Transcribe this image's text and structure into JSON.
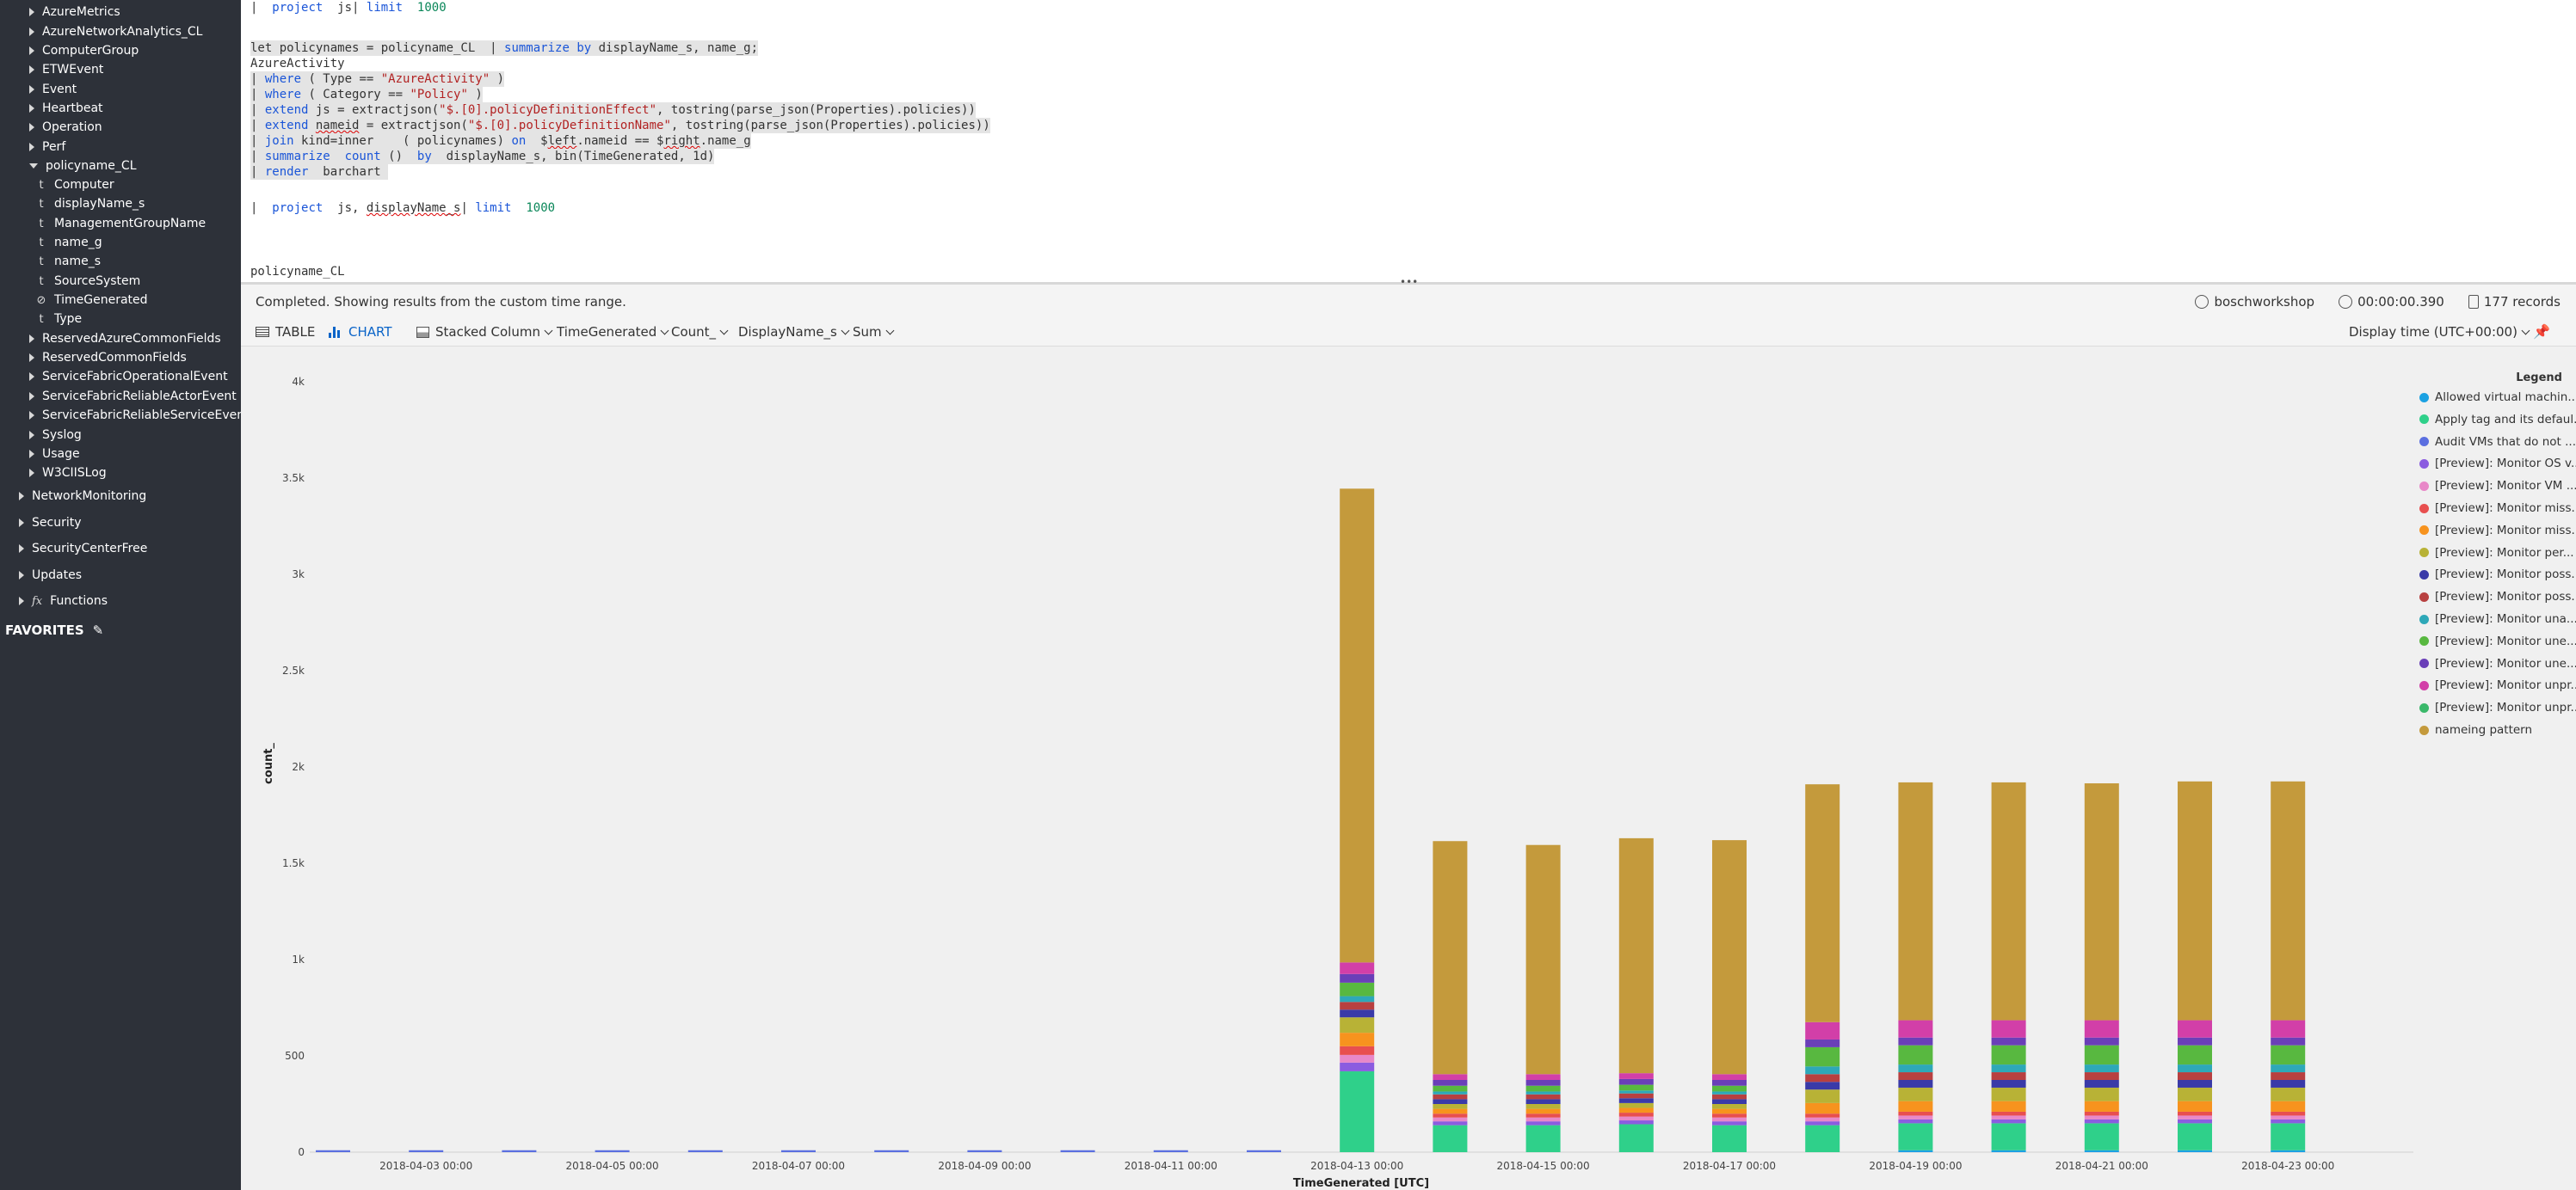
{
  "sidebar": {
    "items": [
      {
        "label": "AzureMetrics",
        "indent": 1,
        "kind": "table"
      },
      {
        "label": "AzureNetworkAnalytics_CL",
        "indent": 1,
        "kind": "table"
      },
      {
        "label": "ComputerGroup",
        "indent": 1,
        "kind": "table"
      },
      {
        "label": "ETWEvent",
        "indent": 1,
        "kind": "table"
      },
      {
        "label": "Event",
        "indent": 1,
        "kind": "table"
      },
      {
        "label": "Heartbeat",
        "indent": 1,
        "kind": "table"
      },
      {
        "label": "Operation",
        "indent": 1,
        "kind": "table"
      },
      {
        "label": "Perf",
        "indent": 1,
        "kind": "table"
      },
      {
        "label": "policyname_CL",
        "indent": 1,
        "kind": "table-open"
      },
      {
        "label": "Computer",
        "indent": 2,
        "kind": "text"
      },
      {
        "label": "displayName_s",
        "indent": 2,
        "kind": "text"
      },
      {
        "label": "ManagementGroupName",
        "indent": 2,
        "kind": "text"
      },
      {
        "label": "name_g",
        "indent": 2,
        "kind": "text"
      },
      {
        "label": "name_s",
        "indent": 2,
        "kind": "text"
      },
      {
        "label": "SourceSystem",
        "indent": 2,
        "kind": "text"
      },
      {
        "label": "TimeGenerated",
        "indent": 2,
        "kind": "time"
      },
      {
        "label": "Type",
        "indent": 2,
        "kind": "text"
      },
      {
        "label": "ReservedAzureCommonFields",
        "indent": 1,
        "kind": "table"
      },
      {
        "label": "ReservedCommonFields",
        "indent": 1,
        "kind": "table"
      },
      {
        "label": "ServiceFabricOperationalEvent",
        "indent": 1,
        "kind": "table"
      },
      {
        "label": "ServiceFabricReliableActorEvent",
        "indent": 1,
        "kind": "table"
      },
      {
        "label": "ServiceFabricReliableServiceEvent",
        "indent": 1,
        "kind": "table"
      },
      {
        "label": "Syslog",
        "indent": 1,
        "kind": "table"
      },
      {
        "label": "Usage",
        "indent": 1,
        "kind": "table"
      },
      {
        "label": "W3CIISLog",
        "indent": 1,
        "kind": "table"
      },
      {
        "label": "NetworkMonitoring",
        "indent": 0,
        "kind": "group"
      },
      {
        "label": "Security",
        "indent": 0,
        "kind": "group"
      },
      {
        "label": "SecurityCenterFree",
        "indent": 0,
        "kind": "group"
      },
      {
        "label": "Updates",
        "indent": 0,
        "kind": "group"
      },
      {
        "label": "Functions",
        "indent": 0,
        "kind": "functions"
      }
    ],
    "text_icon": "t",
    "time_icon": "⊘",
    "fx_icon": "fx",
    "favorites_label": "FAVORITES",
    "favorites_icon": "pencil-icon"
  },
  "editor": {
    "lines": [
      {
        "top": 0,
        "hl": false,
        "tokens": [
          [
            "plain",
            "|  "
          ],
          [
            "kw",
            "project"
          ],
          [
            "plain",
            "  js| "
          ],
          [
            "kw",
            "limit"
          ],
          [
            "plain",
            "  "
          ],
          [
            "num",
            "1000"
          ]
        ]
      },
      {
        "top": 51,
        "hl": true,
        "tokens": [
          [
            "plain",
            "let policynames = policyname_CL  | "
          ],
          [
            "kw",
            "summarize"
          ],
          [
            "plain",
            " "
          ],
          [
            "kw",
            "by"
          ],
          [
            "plain",
            " displayName_s, name_g;"
          ]
        ]
      },
      {
        "top": 69,
        "hl": false,
        "tokens": [
          [
            "plain",
            "AzureActivity"
          ]
        ]
      },
      {
        "top": 87,
        "hl": true,
        "tokens": [
          [
            "plain",
            "| "
          ],
          [
            "kw",
            "where"
          ],
          [
            "plain",
            " ( Type == "
          ],
          [
            "str",
            "\"AzureActivity\""
          ],
          [
            "plain",
            " )"
          ]
        ]
      },
      {
        "top": 105,
        "hl": true,
        "tokens": [
          [
            "plain",
            "| "
          ],
          [
            "kw",
            "where"
          ],
          [
            "plain",
            " ( Category == "
          ],
          [
            "str",
            "\"Policy\""
          ],
          [
            "plain",
            " )"
          ]
        ]
      },
      {
        "top": 123,
        "hl": true,
        "tokens": [
          [
            "plain",
            "| "
          ],
          [
            "kw",
            "extend"
          ],
          [
            "plain",
            " js = extractjson("
          ],
          [
            "str",
            "\"$.[0].policyDefinitionEffect\""
          ],
          [
            "plain",
            ", tostring(parse_json(Properties).policies))"
          ]
        ]
      },
      {
        "top": 141,
        "hl": true,
        "tokens": [
          [
            "plain",
            "| "
          ],
          [
            "kw",
            "extend"
          ],
          [
            "plain",
            " "
          ],
          [
            "squig",
            "nameid"
          ],
          [
            "plain",
            " = extractjson("
          ],
          [
            "str",
            "\"$.[0].policyDefinitionName\""
          ],
          [
            "plain",
            ", tostring(parse_json(Properties).policies))"
          ]
        ]
      },
      {
        "top": 159,
        "hl": true,
        "tokens": [
          [
            "plain",
            "| "
          ],
          [
            "kw",
            "join"
          ],
          [
            "plain",
            " kind=inner    ( policynames) "
          ],
          [
            "kw",
            "on"
          ],
          [
            "plain",
            "  $"
          ],
          [
            "squig",
            "left"
          ],
          [
            "plain",
            ".nameid == $"
          ],
          [
            "squig",
            "right"
          ],
          [
            "plain",
            ".name_g"
          ]
        ]
      },
      {
        "top": 177,
        "hl": true,
        "tokens": [
          [
            "plain",
            "| "
          ],
          [
            "kw",
            "summarize"
          ],
          [
            "plain",
            "  "
          ],
          [
            "kw",
            "count"
          ],
          [
            "plain",
            " ()  "
          ],
          [
            "kw",
            "by"
          ],
          [
            "plain",
            "  displayName_s, bin(TimeGenerated, 1d)"
          ]
        ]
      },
      {
        "top": 195,
        "hl": true,
        "tokens": [
          [
            "plain",
            "| "
          ],
          [
            "kw",
            "render"
          ],
          [
            "plain",
            "  barchart "
          ]
        ]
      },
      {
        "top": 237,
        "hl": false,
        "tokens": [
          [
            "plain",
            "|  "
          ],
          [
            "kw",
            "project"
          ],
          [
            "plain",
            "  js, "
          ],
          [
            "squig",
            "displayName_s"
          ],
          [
            "plain",
            "| "
          ],
          [
            "kw",
            "limit"
          ],
          [
            "plain",
            "  "
          ],
          [
            "num",
            "1000"
          ]
        ]
      },
      {
        "top": 311,
        "hl": false,
        "tokens": [
          [
            "plain",
            "policyname_CL"
          ]
        ]
      }
    ]
  },
  "status": {
    "text": "Completed. Showing results from the custom time range.",
    "workspace": "boschworkshop",
    "duration": "00:00:00.390",
    "records": "177 records"
  },
  "toolbar": {
    "table_label": "TABLE",
    "chart_label": "CHART",
    "chart_type": "Stacked Column",
    "x_field": "TimeGenerated",
    "y_field": "Count_",
    "split_field": "DisplayName_s",
    "aggregation": "Sum",
    "display_time": "Display time (UTC+00:00)",
    "pin_icon": "pin-icon"
  },
  "chart_data": {
    "type": "bar",
    "stacked": true,
    "xlabel": "TimeGenerated [UTC]",
    "ylabel": "count_",
    "ylim": [
      0,
      4000
    ],
    "yticks": [
      0,
      500,
      1000,
      1500,
      2000,
      2500,
      3000,
      3500,
      4000
    ],
    "ytick_labels": [
      "0",
      "500",
      "1k",
      "1.5k",
      "2k",
      "2.5k",
      "3k",
      "3.5k",
      "4k"
    ],
    "xtick_labels": [
      "2018-04-03 00:00",
      "2018-04-05 00:00",
      "2018-04-07 00:00",
      "2018-04-09 00:00",
      "2018-04-11 00:00",
      "2018-04-13 00:00",
      "2018-04-15 00:00",
      "2018-04-17 00:00",
      "2018-04-19 00:00",
      "2018-04-21 00:00",
      "2018-04-23 00:00"
    ],
    "categories": [
      "2018-04-02",
      "2018-04-03",
      "2018-04-04",
      "2018-04-05",
      "2018-04-06",
      "2018-04-07",
      "2018-04-08",
      "2018-04-09",
      "2018-04-10",
      "2018-04-11",
      "2018-04-12",
      "2018-04-13",
      "2018-04-14",
      "2018-04-15",
      "2018-04-16",
      "2018-04-17",
      "2018-04-18",
      "2018-04-19",
      "2018-04-20",
      "2018-04-21",
      "2018-04-22",
      "2018-04-23"
    ],
    "legend_title": "Legend",
    "legend_position": "right",
    "series": [
      {
        "name": "Allowed virtual machin...",
        "color": "#1ba1e2",
        "values": [
          0,
          0,
          0,
          0,
          0,
          0,
          0,
          0,
          0,
          0,
          0,
          0,
          0,
          0,
          0,
          0,
          0,
          10,
          10,
          10,
          10,
          10
        ]
      },
      {
        "name": "Apply tag and its defaul...",
        "color": "#2fd08a",
        "values": [
          0,
          0,
          0,
          0,
          0,
          0,
          0,
          0,
          0,
          0,
          0,
          420,
          140,
          140,
          145,
          140,
          140,
          140,
          140,
          140,
          140,
          140
        ]
      },
      {
        "name": "Audit VMs that do not ...",
        "color": "#5b6fe0",
        "values": [
          10,
          10,
          10,
          10,
          10,
          10,
          10,
          10,
          10,
          10,
          10,
          0,
          0,
          0,
          0,
          0,
          0,
          0,
          0,
          0,
          0,
          0
        ]
      },
      {
        "name": "[Preview]: Monitor OS v...",
        "color": "#8b5ce0",
        "values": [
          0,
          0,
          0,
          0,
          0,
          0,
          0,
          0,
          0,
          0,
          0,
          45,
          20,
          20,
          20,
          20,
          20,
          20,
          20,
          20,
          20,
          20
        ]
      },
      {
        "name": "[Preview]: Monitor VM ...",
        "color": "#e888c8",
        "values": [
          0,
          0,
          0,
          0,
          0,
          0,
          0,
          0,
          0,
          0,
          0,
          40,
          20,
          20,
          20,
          20,
          20,
          20,
          20,
          20,
          20,
          20
        ]
      },
      {
        "name": "[Preview]: Monitor miss...",
        "color": "#e84f4f",
        "values": [
          0,
          0,
          0,
          0,
          0,
          0,
          0,
          0,
          0,
          0,
          0,
          45,
          20,
          20,
          20,
          20,
          20,
          20,
          20,
          20,
          20,
          20
        ]
      },
      {
        "name": "[Preview]: Monitor miss...",
        "color": "#f7931e",
        "values": [
          0,
          0,
          0,
          0,
          0,
          0,
          0,
          0,
          0,
          0,
          0,
          70,
          25,
          25,
          25,
          25,
          55,
          55,
          55,
          55,
          55,
          55
        ]
      },
      {
        "name": "[Preview]: Monitor per...",
        "color": "#b8b236",
        "values": [
          0,
          0,
          0,
          0,
          0,
          0,
          0,
          0,
          0,
          0,
          0,
          80,
          25,
          25,
          25,
          25,
          70,
          70,
          70,
          70,
          70,
          70
        ]
      },
      {
        "name": "[Preview]: Monitor poss...",
        "color": "#3a3aa8",
        "values": [
          0,
          0,
          0,
          0,
          0,
          0,
          0,
          0,
          0,
          0,
          0,
          40,
          25,
          25,
          25,
          25,
          40,
          40,
          40,
          40,
          40,
          40
        ]
      },
      {
        "name": "[Preview]: Monitor poss...",
        "color": "#b84040",
        "values": [
          0,
          0,
          0,
          0,
          0,
          0,
          0,
          0,
          0,
          0,
          0,
          40,
          25,
          25,
          25,
          25,
          40,
          40,
          40,
          40,
          40,
          40
        ]
      },
      {
        "name": "[Preview]: Monitor una...",
        "color": "#2ea8b8",
        "values": [
          0,
          0,
          0,
          0,
          0,
          0,
          0,
          0,
          0,
          0,
          0,
          30,
          15,
          15,
          15,
          15,
          40,
          40,
          40,
          40,
          40,
          40
        ]
      },
      {
        "name": "[Preview]: Monitor une...",
        "color": "#58b840",
        "values": [
          0,
          0,
          0,
          0,
          0,
          0,
          0,
          0,
          0,
          0,
          0,
          70,
          30,
          30,
          30,
          30,
          100,
          100,
          100,
          100,
          100,
          100
        ]
      },
      {
        "name": "[Preview]: Monitor une...",
        "color": "#6a3fb8",
        "values": [
          0,
          0,
          0,
          0,
          0,
          0,
          0,
          0,
          0,
          0,
          0,
          45,
          30,
          30,
          30,
          30,
          40,
          40,
          40,
          40,
          40,
          40
        ]
      },
      {
        "name": "[Preview]: Monitor unpr...",
        "color": "#d23fa8",
        "values": [
          0,
          0,
          0,
          0,
          0,
          0,
          0,
          0,
          0,
          0,
          0,
          60,
          30,
          30,
          30,
          30,
          90,
          90,
          90,
          90,
          90,
          90
        ]
      },
      {
        "name": "[Preview]: Monitor unpr...",
        "color": "#3ab86a",
        "values": [
          0,
          0,
          0,
          0,
          0,
          0,
          0,
          0,
          0,
          0,
          0,
          0,
          0,
          0,
          0,
          0,
          0,
          0,
          0,
          0,
          0,
          0
        ]
      },
      {
        "name": "nameing pattern",
        "color": "#c49a3c",
        "values": [
          0,
          0,
          0,
          0,
          0,
          0,
          0,
          0,
          0,
          0,
          0,
          2460,
          1210,
          1190,
          1220,
          1215,
          1235,
          1235,
          1235,
          1230,
          1240,
          1240
        ]
      }
    ]
  }
}
